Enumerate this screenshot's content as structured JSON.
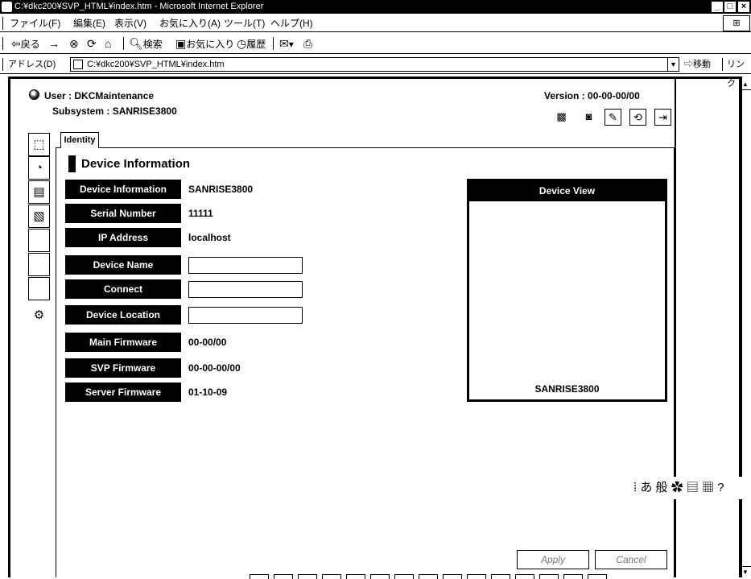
{
  "window": {
    "title": "C:¥dkc200¥SVP_HTML¥index.htm - Microsoft Internet Explorer",
    "controls": [
      "_",
      "□",
      "×"
    ]
  },
  "menu": {
    "items": [
      "ファイル(F)",
      "編集(E)",
      "表示(V)",
      "お気に入り(A)",
      "ツール(T)",
      "ヘルプ(H)"
    ]
  },
  "toolbar": {
    "back_label": "戻る",
    "forward_glyph": "→",
    "stop_glyph": "⊗",
    "refresh_glyph": "⟳",
    "home_glyph": "⌂",
    "search_label": "検索",
    "favorites_label": "お気に入り",
    "history_label": "履歴",
    "mail_glyph": "✉",
    "print_glyph": "⎙"
  },
  "address": {
    "label": "アドレス(D)",
    "url": "C:¥dkc200¥SVP_HTML¥index.htm",
    "go_label": "移動",
    "links_label": "リンク"
  },
  "header": {
    "user_prefix": "User : ",
    "user": "DKCMaintenance",
    "subsystem_prefix": "Subsystem :  ",
    "subsystem": "SANRISE3800",
    "version_prefix": "Version : ",
    "version": "00-00-00/00"
  },
  "tabs": [
    {
      "label": "Identity"
    }
  ],
  "section": {
    "title": "Device Information"
  },
  "rows": [
    {
      "label": "Device Information",
      "value": "SANRISE3800"
    },
    {
      "label": "Serial Number",
      "value": "11111"
    },
    {
      "label": "IP Address",
      "value": "localhost"
    },
    {
      "label": "Device Name",
      "value": ""
    },
    {
      "label": "Connect",
      "value": ""
    },
    {
      "label": "Device Location",
      "value": ""
    },
    {
      "label": "Main Firmware",
      "value": "00-00/00"
    },
    {
      "label": "SVP Firmware",
      "value": "00-00-00/00"
    },
    {
      "label": "Server Firmware",
      "value": "01-10-09"
    }
  ],
  "device_view": {
    "title": "Device View",
    "name": "SANRISE3800"
  },
  "ime": {
    "text": "あ 般"
  },
  "buttons": {
    "apply": "Apply",
    "cancel": "Cancel"
  }
}
